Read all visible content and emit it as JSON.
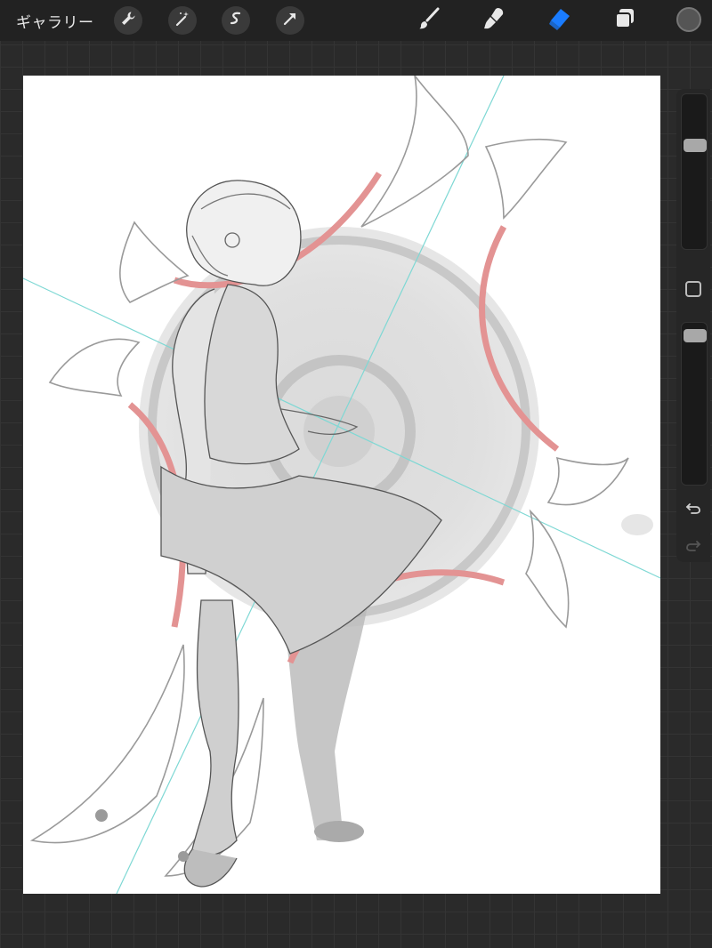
{
  "topbar": {
    "gallery_label": "ギャラリー",
    "left_tools": [
      "wrench-icon",
      "magic-wand-icon",
      "selection-icon",
      "transform-arrow-icon"
    ],
    "right_tools": [
      "brush-icon",
      "smudge-icon",
      "eraser-icon",
      "layers-icon"
    ],
    "active_tool": "eraser-icon",
    "active_color": "#1a7cff",
    "current_color": "#555555"
  },
  "sidebar": {
    "brush_size_level": 0.38,
    "opacity_level": 0.95,
    "controls": [
      "brush-size-slider",
      "modify-button",
      "opacity-slider",
      "undo-icon",
      "redo-icon"
    ]
  },
  "canvas": {
    "background": "#ffffff",
    "content": "sketch-artwork"
  }
}
